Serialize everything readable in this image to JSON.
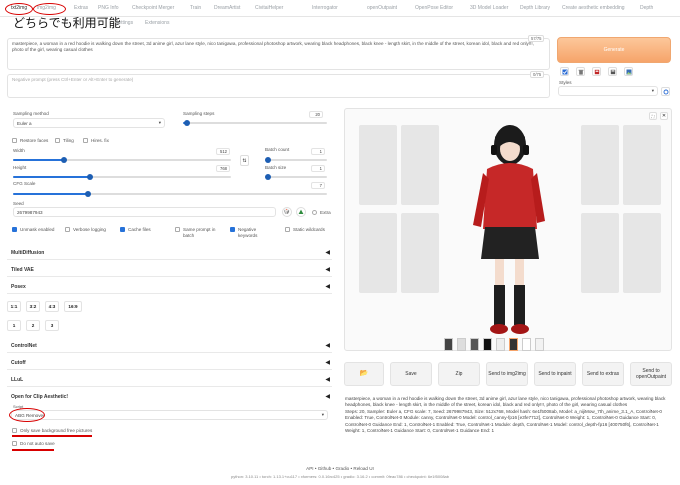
{
  "tabs": [
    "txt2img",
    "img2img",
    "Extras",
    "PNG Info",
    "Checkpoint Merger",
    "Train",
    "DreamArtist",
    "CivitaiHelper",
    "Interrogator",
    "openOutpaint",
    "OpenPose Editor",
    "3D Model Loader",
    "Depth Library",
    "Create aesthetic embedding",
    "Depth"
  ],
  "tabs_row2": [
    "Settings",
    "Extensions"
  ],
  "overlay_text": "どちらでも利用可能",
  "prompt": {
    "value": "masterpiece, a woman in a red hoodie is walking down the street, 3d anime girl, azur lane style, nico tanigawa, professional photoshop artwork, wearing black headphones, black knee - length skirt, in the middle of the street, korean idol, black and red only!!!, photo of the girl, wearing casual clothes",
    "counter": "57/75"
  },
  "negative_prompt": {
    "placeholder": "Negative prompt (press Ctrl+Enter or Alt+Enter to generate)",
    "counter": "0/75"
  },
  "generate_label": "Generate",
  "styles_label": "Styles",
  "sampling": {
    "method_label": "Sampling method",
    "method_value": "Euler a",
    "steps_label": "Sampling steps",
    "steps_value": "20"
  },
  "checkboxes_top": [
    "Restore faces",
    "Tiling",
    "Hires. fix"
  ],
  "width": {
    "label": "Width",
    "value": "512"
  },
  "height": {
    "label": "Height",
    "value": "768"
  },
  "batch_count": {
    "label": "Batch count",
    "value": "1"
  },
  "batch_size": {
    "label": "Batch size",
    "value": "1"
  },
  "cfg": {
    "label": "CFG Scale",
    "value": "7"
  },
  "seed": {
    "label": "Seed",
    "value": "2679987943",
    "extra": "Extra"
  },
  "options": {
    "unmask": "Unmask enabled",
    "verbose": "Verbose logging",
    "cache": "Cache files",
    "same_prompt": "Same prompt in batch",
    "negative_keywords": "Negative keywords",
    "static": "Static wildcards"
  },
  "sections": [
    "MultiDiffusion",
    "Tiled VAE",
    "Posex",
    "ControlNet",
    "Cutoff",
    "LLuL",
    "Open for Clip Aesthetic!"
  ],
  "ratio_buttons": [
    "1:1",
    "3:2",
    "4:3",
    "16:9"
  ],
  "count_buttons": [
    "1",
    "2",
    "3"
  ],
  "script": {
    "label": "Script",
    "value": "ABG Remover",
    "option1": "Only save background free pictures",
    "option2": "Do not auto save"
  },
  "actions": [
    "Save",
    "Zip",
    "Send to img2img",
    "Send to inpaint",
    "Send to extras",
    "Send to openOutpaint"
  ],
  "info_text": "masterpiece, a woman in a red hoodie is walking down the street, 3d anime girl, azur lane style, nico tanigawa, professional photoshop artwork, wearing black headphones, black knee - length skirt, in the middle of the street, korean idol, black and red only!!!, photo of the girl, wearing casual clothes\nSteps: 20, Sampler: Euler a, CFG scale: 7, Seed: 2679987943, Size: 512x768, Model hash: 6e1f5008ab, Model: a_nijiMow_7th_anime_3.1_A, ControlNet-0 Enabled: True, ControlNet-0 Module: canny, ControlNet-0 Model: control_canny-fp16 [e3fe7712], ControlNet-0 Weight: 1, ControlNet-0 Guidance Start: 0, ControlNet-0 Guidance End: 1, ControlNet-1 Enabled: True, ControlNet-1 Module: depth, ControlNet-1 Model: control_depth-fp16 [400750f6], ControlNet-1 Weight: 1, ControlNet-1 Guidance Start: 0, ControlNet-1 Guidance End: 1",
  "footer_links": [
    "API",
    "Github",
    "Gradio",
    "Reload UI"
  ],
  "footer_versions": "python: 3.10.11  •  torch: 1.13.1+cu117  •  xformers: 0.0.16rc425  •  gradio: 3.16.2  •  commit: 0feac786  •  checkpoint: 6e1f5008ab",
  "colors": {
    "accent_orange": "#f6a46a",
    "annotation_red": "#d80000",
    "slider_blue": "#2672d9",
    "hoodie_red": "#c62828"
  }
}
